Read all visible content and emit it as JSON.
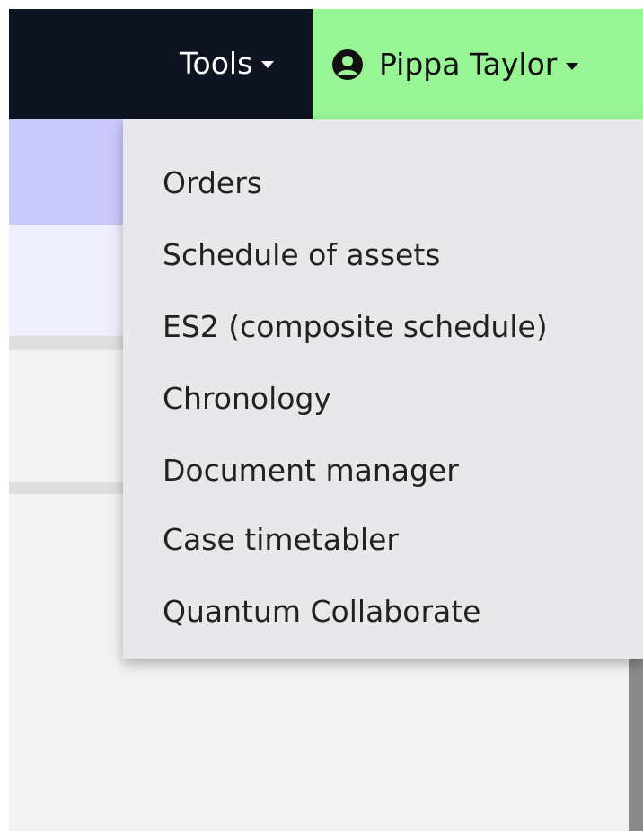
{
  "colors": {
    "navbar_bg": "#0f1423",
    "user_menu_bg": "#98f595",
    "page_purple": "#cbc8fb",
    "page_lavender": "#efeefe",
    "dropdown_bg": "#e8e7ea"
  },
  "navbar": {
    "tools_label": "Tools",
    "user_name": "Pippa Taylor",
    "user_icon": "user-circle-icon",
    "caret_icon": "caret-down-icon"
  },
  "tools_menu": {
    "items": [
      {
        "label": "Orders"
      },
      {
        "label": "Schedule of assets"
      },
      {
        "label": "ES2 (composite schedule)"
      },
      {
        "label": "Chronology"
      },
      {
        "label": "Document manager"
      },
      {
        "label": "Case timetabler"
      },
      {
        "label": "Quantum Collaborate"
      }
    ]
  }
}
